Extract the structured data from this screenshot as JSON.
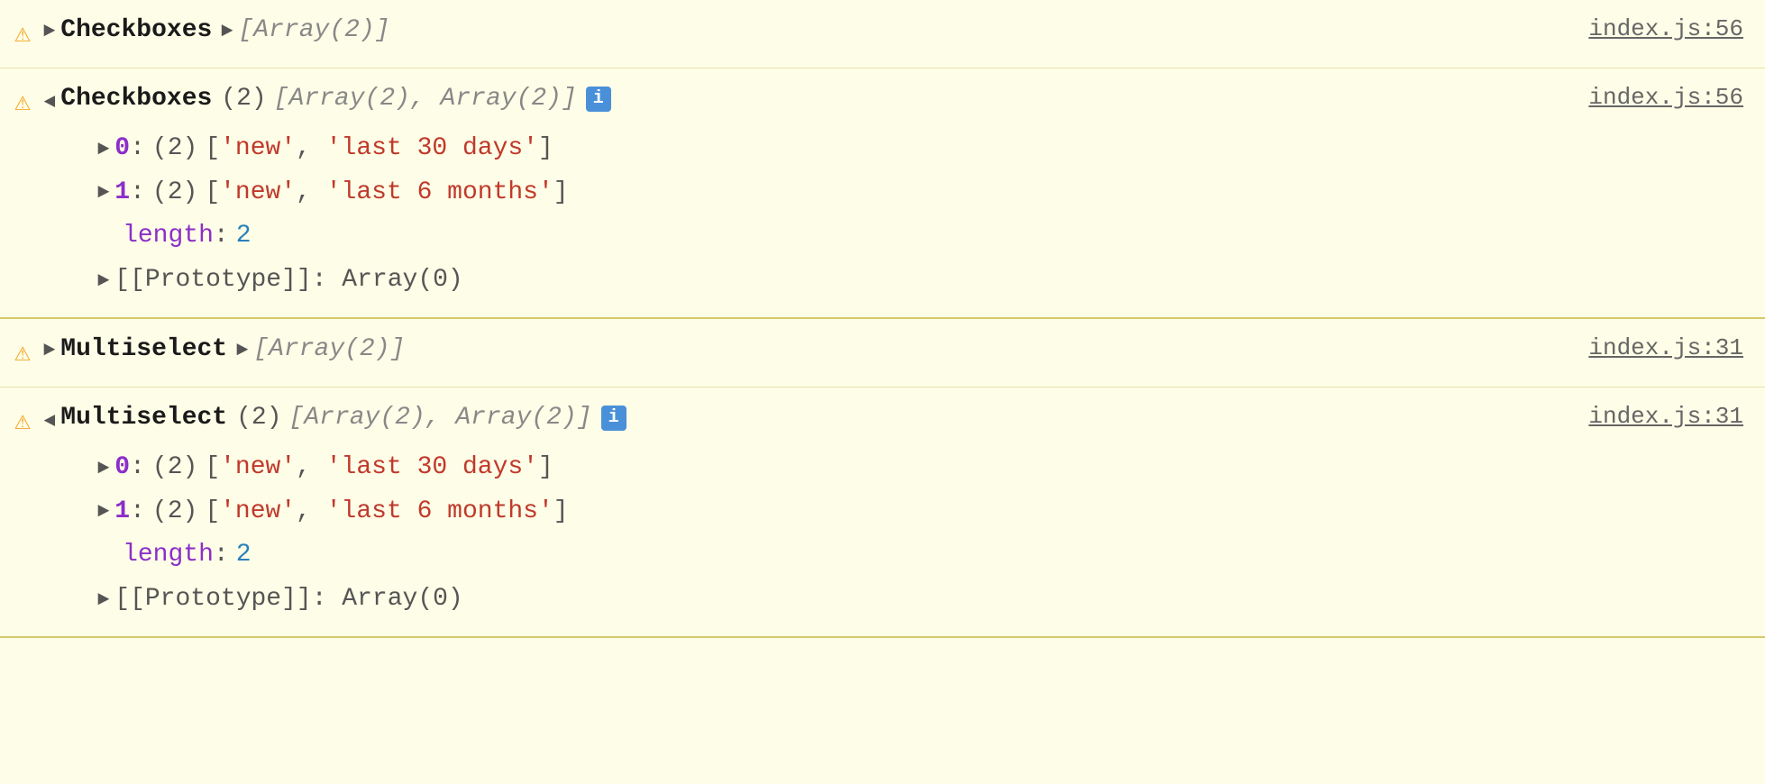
{
  "console": {
    "rows": [
      {
        "id": "row1",
        "warning": "⚠",
        "label": "Checkboxes",
        "triangle": "►",
        "expanded": false,
        "summary": "[Array(2)]",
        "fileLink": "index.js:56"
      },
      {
        "id": "row2",
        "warning": "⚠",
        "label": "Checkboxes",
        "triangle": "▼",
        "expanded": true,
        "count": "(2)",
        "summary": "[Array(2), Array(2)]",
        "infoBadge": "i",
        "fileLink": "index.js:56",
        "items": [
          {
            "index": "0",
            "count": "(2)",
            "values": [
              "'new'",
              "'last 30 days'"
            ]
          },
          {
            "index": "1",
            "count": "(2)",
            "values": [
              "'new'",
              "'last 6 months'"
            ]
          }
        ],
        "length": "2",
        "prototype": "[[Prototype]]: Array(0)"
      },
      {
        "id": "row3",
        "warning": "⚠",
        "label": "Multiselect",
        "triangle": "►",
        "expanded": false,
        "summary": "[Array(2)]",
        "fileLink": "index.js:31"
      },
      {
        "id": "row4",
        "warning": "⚠",
        "label": "Multiselect",
        "triangle": "▼",
        "expanded": true,
        "count": "(2)",
        "summary": "[Array(2), Array(2)]",
        "infoBadge": "i",
        "fileLink": "index.js:31",
        "items": [
          {
            "index": "0",
            "count": "(2)",
            "values": [
              "'new'",
              "'last 30 days'"
            ]
          },
          {
            "index": "1",
            "count": "(2)",
            "values": [
              "'new'",
              "'last 6 months'"
            ]
          }
        ],
        "length": "2",
        "prototype": "[[Prototype]]: Array(0)"
      }
    ]
  }
}
